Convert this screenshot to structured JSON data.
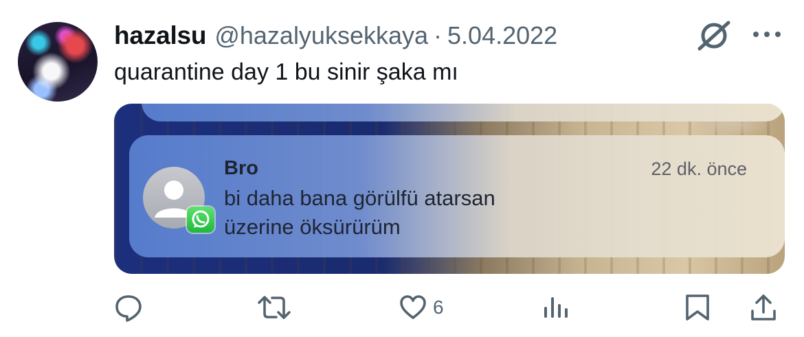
{
  "tweet": {
    "display_name": "hazalsu",
    "handle": "@hazalyuksekkaya",
    "separator": "·",
    "date": "5.04.2022",
    "text": "quarantine day 1 bu sinir şaka mı"
  },
  "media": {
    "notification": {
      "sender": "Bro",
      "time": "22 dk. önce",
      "message_line1": "bi daha bana görülfü atarsan",
      "message_line2": "üzerine öksürürüm",
      "app_icon": "whatsapp-icon"
    }
  },
  "actions": {
    "reply_icon": "reply-icon",
    "retweet_icon": "retweet-icon",
    "like_icon": "heart-icon",
    "like_count": "6",
    "views_icon": "views-icon",
    "bookmark_icon": "bookmark-icon",
    "share_icon": "share-icon"
  },
  "header_icons": {
    "grok": "grok-icon",
    "more": "more-icon"
  },
  "colors": {
    "text_primary": "#0f1419",
    "text_secondary": "#536471",
    "notif_blue": "#1c2f7d",
    "whatsapp_green": "#25d366"
  }
}
